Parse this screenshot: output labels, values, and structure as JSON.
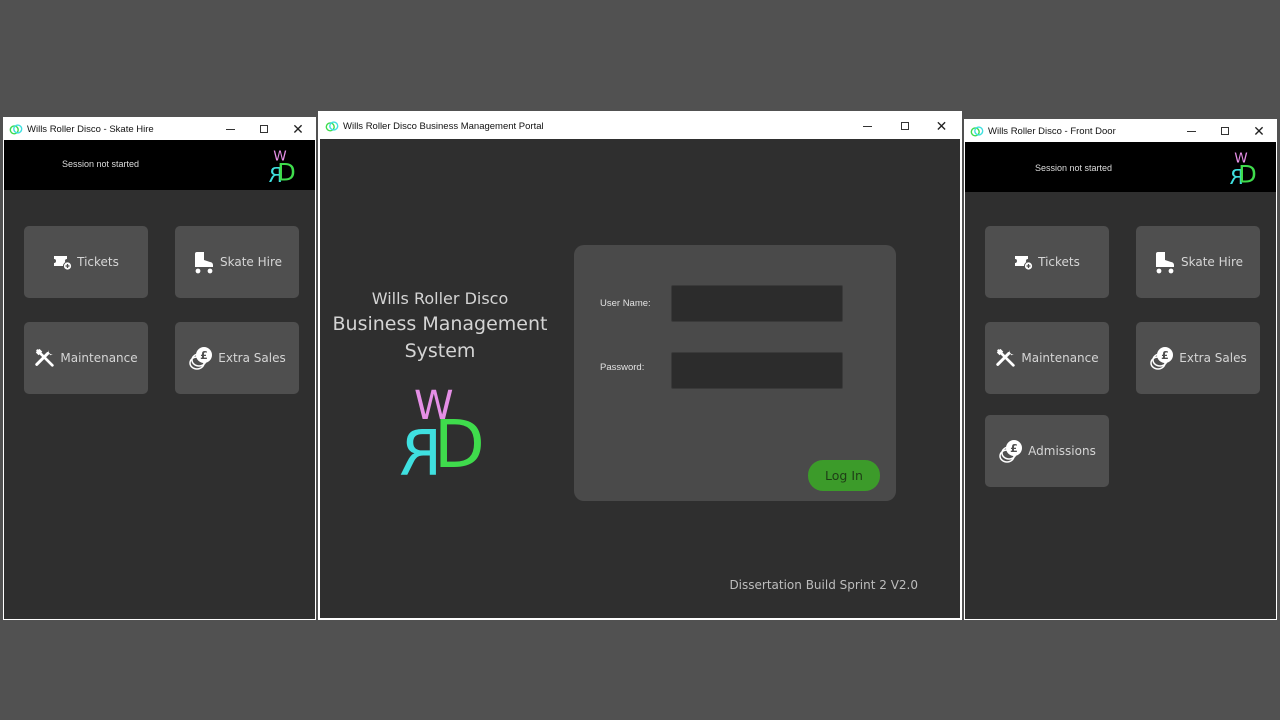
{
  "left_window": {
    "title": "Wills Roller Disco - Skate Hire",
    "session_status": "Session not started",
    "tiles": [
      {
        "label": "Tickets",
        "icon": "ticket-icon"
      },
      {
        "label": "Skate Hire",
        "icon": "roller-skate-icon"
      },
      {
        "label": "Maintenance",
        "icon": "tools-icon"
      },
      {
        "label": "Extra Sales",
        "icon": "coins-icon"
      }
    ]
  },
  "center_window": {
    "title": "Wills Roller Disco Business Management Portal",
    "system_title_line1": "Wills Roller Disco",
    "system_title_line2": "Business Management",
    "system_title_line3": "System",
    "logo_letters": {
      "top": "W",
      "left": "R",
      "right": "D"
    },
    "login": {
      "username_label": "User Name:",
      "username_value": "",
      "password_label": "Password:",
      "password_value": "",
      "login_button": "Log In"
    },
    "footer": "Dissertation Build Sprint 2 V2.0"
  },
  "right_window": {
    "title": "Wills Roller Disco - Front Door",
    "session_status": "Session not started",
    "tiles": [
      {
        "label": "Tickets",
        "icon": "ticket-icon"
      },
      {
        "label": "Skate Hire",
        "icon": "roller-skate-icon"
      },
      {
        "label": "Maintenance",
        "icon": "tools-icon"
      },
      {
        "label": "Extra Sales",
        "icon": "coins-icon"
      },
      {
        "label": "Admissions",
        "icon": "coins-icon"
      }
    ]
  },
  "window_controls": {
    "minimize": "minimize",
    "maximize": "maximize",
    "close": "✕"
  },
  "colors": {
    "desktop": "#515151",
    "window_bg": "#2f2f2f",
    "tile_bg": "#4f4f4f",
    "login_card": "#4a4a4a",
    "login_button": "#3c9b2a",
    "logo_pink": "#e58fe6",
    "logo_cyan": "#3fe0e0",
    "logo_green": "#3fdc4c"
  }
}
